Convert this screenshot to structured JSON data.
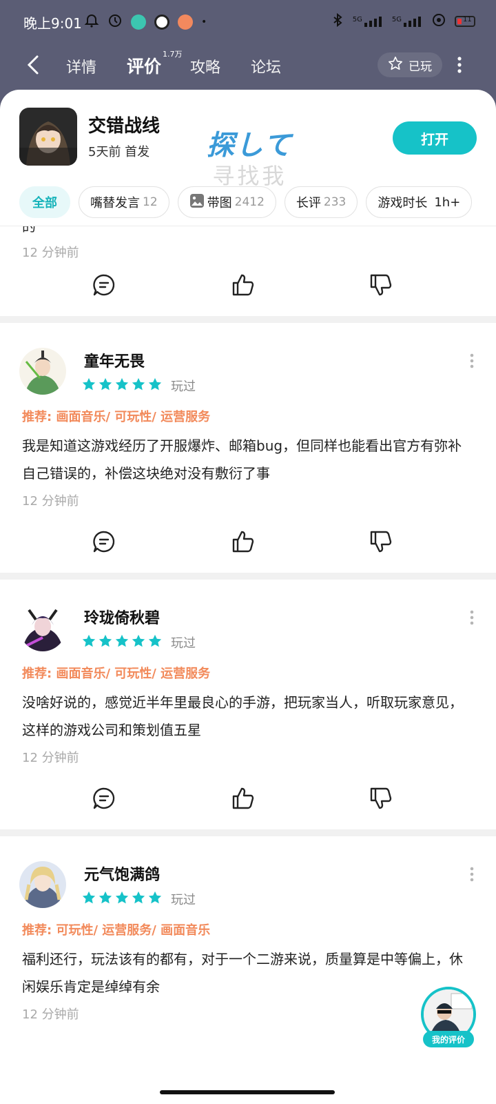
{
  "status_bar": {
    "time": "晚上9:01",
    "signal_1": "5G",
    "signal_2": "5G",
    "battery": "11"
  },
  "nav": {
    "tabs": [
      {
        "label": "详情"
      },
      {
        "label": "评价"
      },
      {
        "label": "攻略"
      },
      {
        "label": "论坛"
      }
    ],
    "review_badge": "1.7万",
    "played_label": "已玩"
  },
  "game": {
    "title": "交错战线",
    "subtitle": "5天前 首发",
    "open_label": "打开",
    "watermark_line1": "探して",
    "watermark_line2": "寻找我"
  },
  "filters": [
    {
      "label": "全部",
      "count": ""
    },
    {
      "label": "嘴替发言",
      "count": "12"
    },
    {
      "label": "带图",
      "count": "2412"
    },
    {
      "label": "长评",
      "count": "233"
    },
    {
      "label": "游戏时长",
      "count": "1h+"
    }
  ],
  "partial_review": {
    "text": "的",
    "time": "12 分钟前"
  },
  "reviews": [
    {
      "name": "童年无畏",
      "played": "玩过",
      "rating": 5,
      "recommend": "推荐: 画面音乐/ 可玩性/ 运营服务",
      "text": "我是知道这游戏经历了开服爆炸、邮箱bug，但同样也能看出官方有弥补自己错误的，补偿这块绝对没有敷衍了事",
      "time": "12 分钟前"
    },
    {
      "name": "玲珑倚秋碧",
      "played": "玩过",
      "rating": 5,
      "recommend": "推荐: 画面音乐/ 可玩性/ 运营服务",
      "text": "没啥好说的，感觉近半年里最良心的手游，把玩家当人，听取玩家意见，这样的游戏公司和策划值五星",
      "time": "12 分钟前"
    },
    {
      "name": "元气饱满鸽",
      "played": "玩过",
      "rating": 5,
      "recommend": "推荐: 可玩性/ 运营服务/ 画面音乐",
      "text": "福利还行，玩法该有的都有，对于一个二游来说，质量算是中等偏上，休闲娱乐肯定是绰绰有余",
      "time": "12 分钟前"
    }
  ],
  "my_review_label": "我的评价",
  "colors": {
    "accent": "#16c2c8",
    "recommend": "#f28a5b",
    "header_bg": "#5b5d75"
  }
}
